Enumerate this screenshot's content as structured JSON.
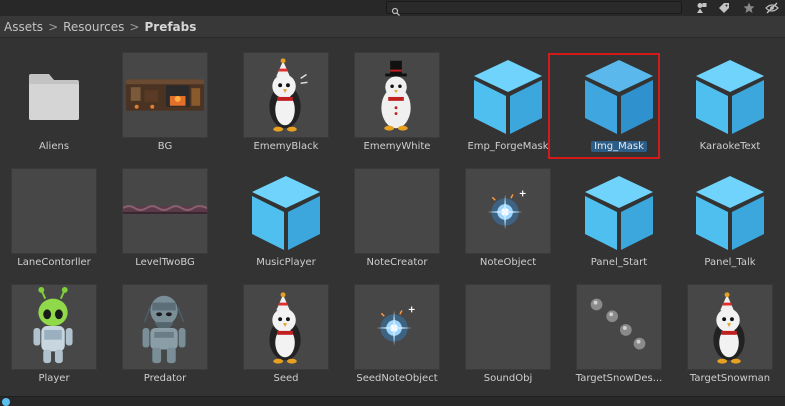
{
  "toolbar": {
    "search": {
      "value": "",
      "placeholder": ""
    },
    "buttons": [
      {
        "name": "filter-by-type-button",
        "icon": "shapes-icon"
      },
      {
        "name": "filter-by-label-button",
        "icon": "tag-icon"
      },
      {
        "name": "favorites-button",
        "icon": "star-icon"
      },
      {
        "name": "hidden-packages-button",
        "icon": "eye-slash-icon"
      }
    ]
  },
  "breadcrumb": {
    "items": [
      "Assets",
      "Resources",
      "Prefabs"
    ],
    "separator": ">"
  },
  "selected_item": "Img_Mask",
  "colors": {
    "cube": "#5cc7f3",
    "cube_dark": "#3fa9dd",
    "selection_outline": "#d11a1a",
    "selection_label": "#2c5d87"
  },
  "items": [
    {
      "name": "Aliens",
      "icon": "folder-icon"
    },
    {
      "name": "BG",
      "icon": "background-image-icon"
    },
    {
      "name": "EmemyBlack",
      "icon": "penguin-black-icon"
    },
    {
      "name": "EmemyWhite",
      "icon": "penguin-white-icon"
    },
    {
      "name": "Emp_ForgeMask",
      "icon": "prefab-cube-icon"
    },
    {
      "name": "Img_Mask",
      "icon": "prefab-cube-icon"
    },
    {
      "name": "KaraokeText",
      "icon": "prefab-cube-icon"
    },
    {
      "name": "LaneContorller",
      "icon": "empty-thumbnail-icon"
    },
    {
      "name": "LevelTwoBG",
      "icon": "strip-image-icon"
    },
    {
      "name": "MusicPlayer",
      "icon": "prefab-cube-icon"
    },
    {
      "name": "NoteCreator",
      "icon": "empty-thumbnail-icon"
    },
    {
      "name": "NoteObject",
      "icon": "sparkle-icon"
    },
    {
      "name": "Panel_Start",
      "icon": "prefab-cube-icon"
    },
    {
      "name": "Panel_Talk",
      "icon": "prefab-cube-icon"
    },
    {
      "name": "Player",
      "icon": "alien-green-icon"
    },
    {
      "name": "Predator",
      "icon": "predator-icon"
    },
    {
      "name": "Seed",
      "icon": "penguin-black-icon"
    },
    {
      "name": "SeedNoteObject",
      "icon": "sparkle-icon"
    },
    {
      "name": "SoundObj",
      "icon": "empty-thumbnail-icon"
    },
    {
      "name": "TargetSnowDes...",
      "icon": "snowballs-icon"
    },
    {
      "name": "TargetSnowman",
      "icon": "penguin-black-icon"
    }
  ]
}
